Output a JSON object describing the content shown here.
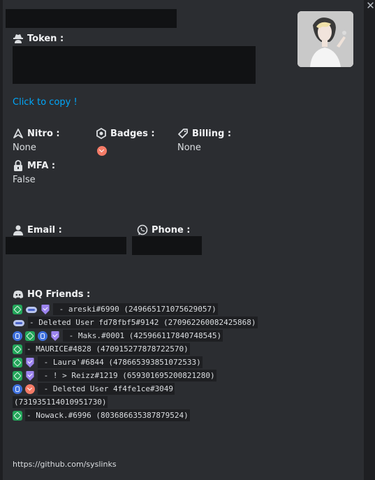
{
  "header": {
    "close_glyph": "✕"
  },
  "token": {
    "label": "Token :",
    "icon": "spy-icon",
    "copy_link": "Click to copy !"
  },
  "nitro": {
    "label": "Nitro :",
    "value": "None"
  },
  "badges": {
    "label": "Badges :"
  },
  "billing": {
    "label": "Billing :",
    "value": "None"
  },
  "mfa": {
    "label": "MFA :",
    "value": "False"
  },
  "email": {
    "label": "Email :"
  },
  "phone": {
    "label": "Phone :"
  },
  "friends": {
    "label": "HQ Friends :",
    "lines": [
      {
        "badges": [
          "green",
          "cloud",
          "purple"
        ],
        "text": " - areski#6990 (249665171075629057)"
      },
      {
        "badges": [
          "cloud"
        ],
        "text": "- Deleted User fd78fbf5#9142 (270962260082425868)"
      },
      {
        "badges": [
          "blue",
          "green",
          "blue",
          "purple"
        ],
        "text": " - Maks.#0001 (425966117840748545)"
      },
      {
        "badges": [
          "green"
        ],
        "text": "- MAURICE#4828 (470915277878722570)"
      },
      {
        "badges": [
          "green",
          "purple"
        ],
        "text": " - Laura'#6844 (478665393851072533)"
      },
      {
        "badges": [
          "green",
          "purple"
        ],
        "text": " - ! > Reizz#1219 (659301695200821280)"
      },
      {
        "badges": [
          "blue",
          "orange"
        ],
        "text": " - Deleted User 4f4fe1ce#3049"
      },
      {
        "badges": [],
        "text": "(731935114010951730)"
      },
      {
        "badges": [
          "green"
        ],
        "text": "- Nowack.#6996 (803686635387879524)"
      }
    ]
  },
  "footer": {
    "github": "https://github.com/syslinks"
  },
  "colors": {
    "background": "#2b2d31",
    "link": "#00a8fc",
    "redaction": "#111214"
  }
}
